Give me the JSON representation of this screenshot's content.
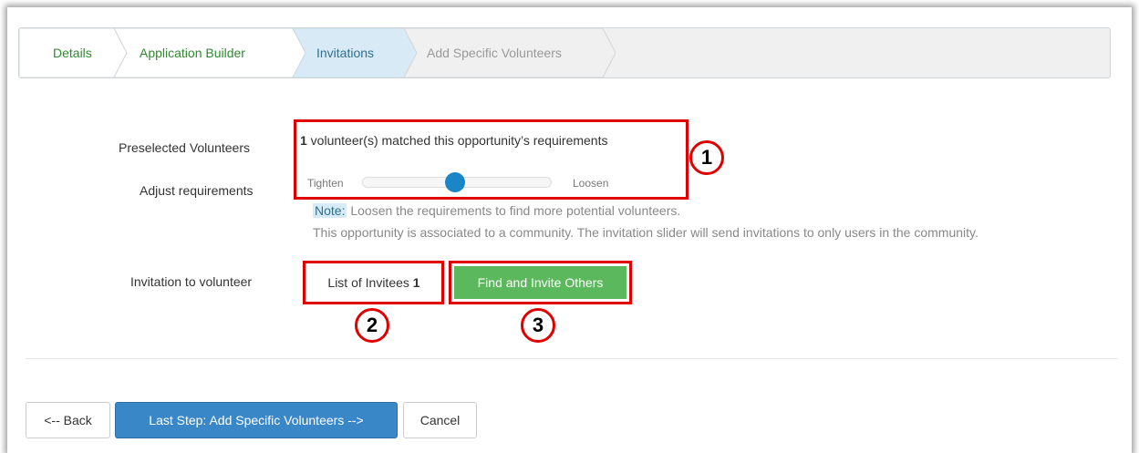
{
  "wizard": {
    "steps": [
      {
        "label": "Details",
        "state": "done"
      },
      {
        "label": "Application Builder",
        "state": "done"
      },
      {
        "label": "Invitations",
        "state": "active"
      },
      {
        "label": "Add Specific Volunteers",
        "state": "pending"
      }
    ]
  },
  "form": {
    "preselected_label": "Preselected Volunteers",
    "matched_count": "1",
    "matched_text": " volunteer(s) matched this opportunity’s requirements",
    "adjust_label": "Adjust requirements",
    "slider": {
      "left_label": "Tighten",
      "right_label": "Loosen",
      "position": 0.5
    },
    "note_tag": "Note:",
    "note_text": "Loosen the requirements to find more potential volunteers.",
    "community_note": "This opportunity is associated to a community. The invitation slider will send invitations to only users in the community.",
    "invitation_label": "Invitation to volunteer",
    "invitees_label": "List of Invitees",
    "invitees_count": "1",
    "find_invite_label": "Find and Invite Others"
  },
  "callouts": [
    "1",
    "2",
    "3"
  ],
  "footer": {
    "back_label": "<-- Back",
    "next_label": "Last Step: Add Specific Volunteers -->",
    "cancel_label": "Cancel"
  },
  "colors": {
    "done_step_text": "#2f8a2f",
    "active_step_bg": "#d8eaf6",
    "annotation_red": "#e00000",
    "success_green": "#5cb85c",
    "primary_blue": "#3a87c8"
  }
}
